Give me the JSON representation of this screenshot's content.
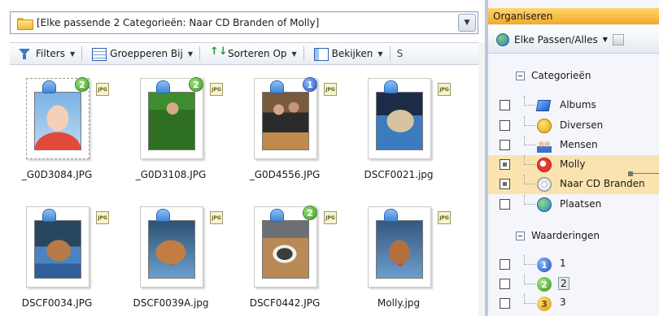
{
  "left_pane": {
    "path": "[Elke passende 2 Categorieën: Naar CD Branden of Molly]",
    "toolbar": {
      "filters": "Filters",
      "group": "Groepperen Bij",
      "sort": "Sorteren Op",
      "view": "Bekijken",
      "cut": "S"
    },
    "thumbnails": [
      {
        "name": "_G0D3084.JPG",
        "badge": "2",
        "badge_color": "green",
        "photo": "baby"
      },
      {
        "name": "_G0D3108.JPG",
        "badge": "2",
        "badge_color": "green",
        "photo": "toy"
      },
      {
        "name": "_G0D4556.JPG",
        "badge": "1",
        "badge_color": "blue",
        "photo": "family"
      },
      {
        "name": "DSCF0021.jpg",
        "badge": "",
        "badge_color": "",
        "photo": "dog1"
      },
      {
        "name": "DSCF0034.JPG",
        "badge": "",
        "badge_color": "",
        "photo": "dog2"
      },
      {
        "name": "DSCF0039A.jpg",
        "badge": "",
        "badge_color": "",
        "photo": "dog3"
      },
      {
        "name": "DSCF0442.JPG",
        "badge": "2",
        "badge_color": "green",
        "photo": "cat"
      },
      {
        "name": "Molly.jpg",
        "badge": "",
        "badge_color": "",
        "photo": "dog4"
      }
    ],
    "jpg_label": "JPG"
  },
  "right_pane": {
    "title": "Organiseren",
    "dropdown": "Elke Passen/Alles",
    "categories_header": "Categorieën",
    "categories": [
      {
        "label": "Albums",
        "icon": "albums-icon",
        "state": "unchecked",
        "highlight": false
      },
      {
        "label": "Diversen",
        "icon": "diversen-icon",
        "state": "unchecked",
        "highlight": false
      },
      {
        "label": "Mensen",
        "icon": "mensen-icon",
        "state": "unchecked",
        "highlight": false
      },
      {
        "label": "Molly",
        "icon": "molly-icon",
        "state": "partial",
        "highlight": true
      },
      {
        "label": "Naar CD Branden",
        "icon": "cd-icon",
        "state": "partial",
        "highlight": true
      },
      {
        "label": "Plaatsen",
        "icon": "plaatsen-icon",
        "state": "unchecked",
        "highlight": false
      }
    ],
    "ratings_header": "Waarderingen",
    "ratings": [
      {
        "label": "1",
        "icon_text": "1",
        "boxed": false
      },
      {
        "label": "2",
        "icon_text": "2",
        "boxed": true
      },
      {
        "label": "3",
        "icon_text": "3",
        "boxed": false
      }
    ]
  }
}
